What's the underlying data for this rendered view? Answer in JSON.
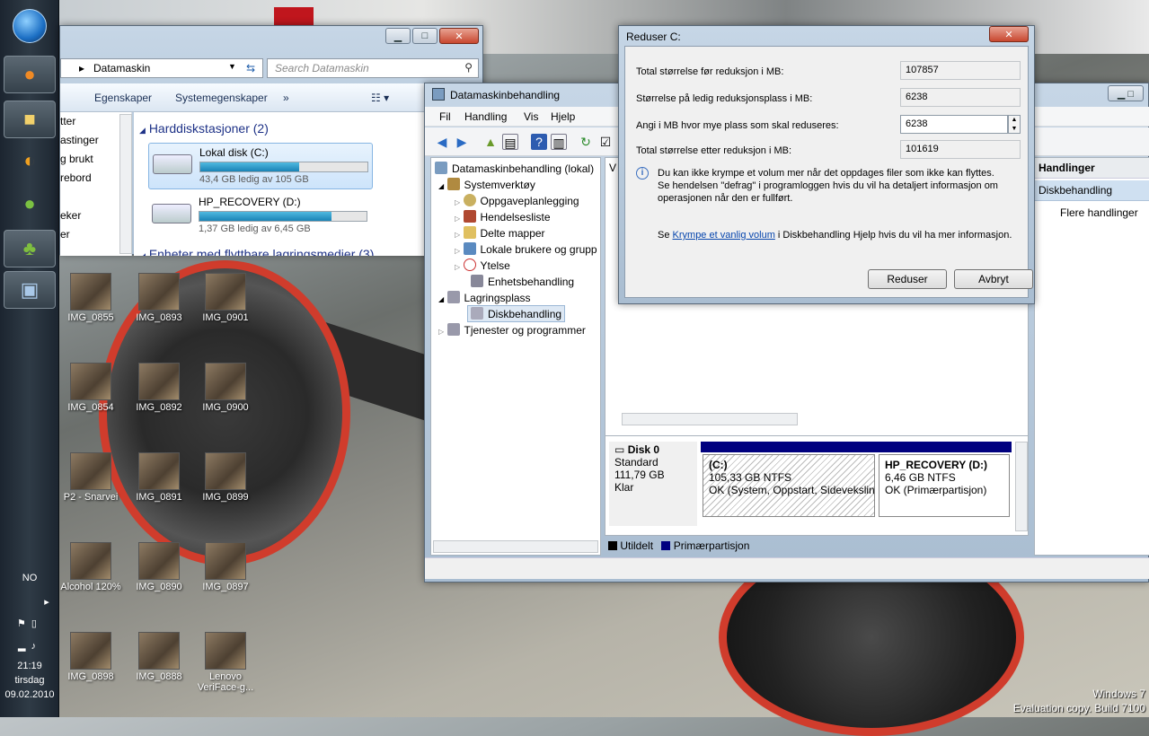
{
  "taskbar": {
    "language": "NO",
    "time": "21:19",
    "day": "tirsdag",
    "date": "09.02.2010"
  },
  "desktop": {
    "icons": [
      {
        "label": "IMG_0855"
      },
      {
        "label": "IMG_0893"
      },
      {
        "label": "IMG_0901"
      },
      {
        "label": "IMG_0854"
      },
      {
        "label": "IMG_0892"
      },
      {
        "label": "IMG_0900"
      },
      {
        "label": "P2 - Snarvei"
      },
      {
        "label": "IMG_0891"
      },
      {
        "label": "IMG_0899"
      },
      {
        "label": "Alcohol 120%"
      },
      {
        "label": "IMG_0890"
      },
      {
        "label": "IMG_0897"
      },
      {
        "label": "IMG_0898"
      },
      {
        "label": "IMG_0888"
      },
      {
        "label": "Lenovo VeriFace-g..."
      }
    ],
    "watermark_line1": "Windows 7",
    "watermark_line2": "Evaluation copy. Build 7100"
  },
  "explorer": {
    "address": "Datamaskin",
    "search_placeholder": "Search Datamaskin",
    "toolbar": {
      "properties": "Egenskaper",
      "system_properties": "Systemegenskaper",
      "more": "»"
    },
    "nav": [
      "tter",
      "astinger",
      "g brukt",
      "rebord",
      "",
      "eker",
      "er"
    ],
    "section_hdd": "Harddiskstasjoner (2)",
    "section_removable": "Enheter med flyttbare lagringsmedier (3)",
    "drives": [
      {
        "name": "Lokal disk (C:)",
        "free": "43,4 GB ledig av 105 GB",
        "used_fraction": 0.59
      },
      {
        "name": "HP_RECOVERY (D:)",
        "free": "1,37 GB ledig av 6,45 GB",
        "used_fraction": 0.79
      }
    ]
  },
  "mgmt": {
    "title": "Datamaskinbehandling",
    "menu": [
      "Fil",
      "Handling",
      "Vis",
      "Hjelp"
    ],
    "tree": {
      "root": "Datamaskinbehandling (lokal)",
      "systemtools": "Systemverktøy",
      "task_scheduler": "Oppgaveplanlegging",
      "event_viewer": "Hendelsesliste",
      "shared_folders": "Delte mapper",
      "local_users": "Lokale brukere og grupp",
      "performance": "Ytelse",
      "device_manager": "Enhetsbehandling",
      "storage": "Lagringsplass",
      "disk_mgmt": "Diskbehandling",
      "services": "Tjenester og programmer"
    },
    "center_header": "V",
    "disk": {
      "name": "Disk 0",
      "type": "Standard",
      "size": "111,79 GB",
      "status": "Klar",
      "partitions": [
        {
          "name": "(C:)",
          "size": "105,33 GB NTFS",
          "status": "OK (System, Oppstart, Sideveksling"
        },
        {
          "name": "HP_RECOVERY  (D:)",
          "size": "6,46 GB NTFS",
          "status": "OK (Primærpartisjon)"
        }
      ]
    },
    "legend": {
      "unallocated": "Utildelt",
      "primary": "Primærpartisjon"
    },
    "actions": {
      "header": "Handlinger",
      "section": "Diskbehandling",
      "more": "Flere handlinger"
    },
    "colors": {
      "primary_partition": "#00007f",
      "unallocated": "#000000"
    }
  },
  "dialog": {
    "title": "Reduser C:",
    "rows": [
      {
        "label": "Total størrelse før reduksjon i MB:",
        "value": "107857"
      },
      {
        "label": "Størrelse på ledig reduksjonsplass i MB:",
        "value": "6238"
      },
      {
        "label": "Angi i MB hvor mye plass som skal reduseres:",
        "value": "6238"
      },
      {
        "label": "Total størrelse etter reduksjon i MB:",
        "value": "101619"
      }
    ],
    "info_text": "Du kan ikke krympe et volum mer når det oppdages filer som ikke kan flyttes. Se hendelsen \"defrag\" i programloggen hvis du vil ha detaljert informasjon om operasjonen når den er fullført.",
    "help_prefix": "Se",
    "help_link": "Krympe et vanlig volum",
    "help_suffix": "i Diskbehandling Hjelp hvis du vil ha mer informasjon.",
    "ok_button": "Reduser",
    "cancel_button": "Avbryt"
  }
}
